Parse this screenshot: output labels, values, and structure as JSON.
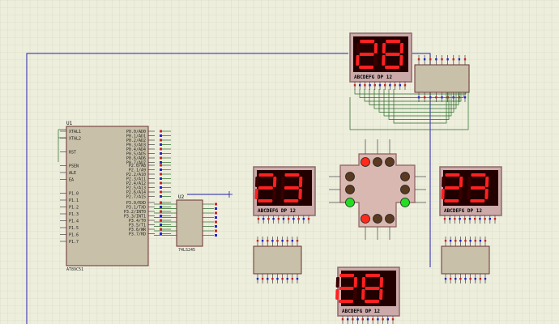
{
  "schematic": {
    "mcu": {
      "ref": "U1",
      "part": "AT89C51",
      "pins_left": [
        "XTAL1",
        "XTAL2",
        "",
        "RST",
        "",
        "PSEN",
        "ALE",
        "EA",
        "",
        "P1.0",
        "P1.1",
        "P1.2",
        "P1.3",
        "P1.4",
        "P1.5",
        "P1.6",
        "P1.7"
      ],
      "pins_right_a": [
        "P0.0/AD0",
        "P0.1/AD1",
        "P0.2/AD2",
        "P0.3/AD3",
        "P0.4/AD4",
        "P0.5/AD5",
        "P0.6/AD6",
        "P0.7/AD7"
      ],
      "pins_right_b": [
        "P2.0/A8",
        "P2.1/A9",
        "P2.2/A10",
        "P2.3/A11",
        "P2.4/A12",
        "P2.5/A13",
        "P2.6/A14",
        "P2.7/A15"
      ],
      "pins_right_c": [
        "P3.0/RXD",
        "P3.1/TXD",
        "P3.2/INT0",
        "P3.3/INT1",
        "P3.4/T0",
        "P3.5/T1",
        "P3.6/WR",
        "P3.7/RD"
      ]
    },
    "buffer": {
      "ref": "U2",
      "part": "74LS245"
    },
    "displays": [
      {
        "name": "north",
        "digits": "28",
        "caption": "ABCDEFG  DP    12"
      },
      {
        "name": "west",
        "digits": "23",
        "caption": "ABCDEFG  DP    12"
      },
      {
        "name": "east",
        "digits": "23",
        "caption": "ABCDEFG  DP    12"
      },
      {
        "name": "south",
        "digits": "28",
        "caption": "ABCDEFG  DP    12"
      }
    ],
    "traffic_lights": {
      "top": [
        "red",
        "off",
        "off"
      ],
      "left": [
        "off",
        "off",
        "green"
      ],
      "right": [
        "off",
        "off",
        "green"
      ],
      "bottom": [
        "red",
        "off",
        "off"
      ]
    },
    "colors": {
      "grid_bg": "#eeeedd",
      "grid_line": "#d2d2c0",
      "wire": "#2a6b2a",
      "blue_wire": "#2222aa",
      "display_frame": "#8a6a6a",
      "display_bg": "#220000",
      "segment_on": "#ff2020",
      "segment_off": "#3a0000",
      "chip_body": "#c8c0a8",
      "light_red": "#ff2a1a",
      "light_green": "#22dd22",
      "light_off": "#5a3a20"
    }
  }
}
